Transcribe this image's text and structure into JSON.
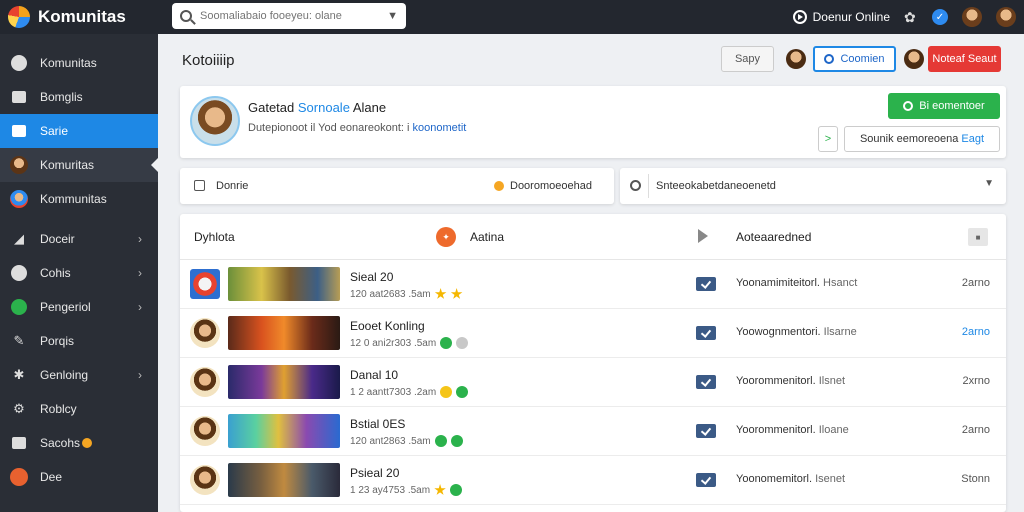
{
  "app": {
    "name": "Komunitas"
  },
  "search": {
    "placeholder": "Soomaliabaio fooeyeu: olane"
  },
  "topbar": {
    "online_label": "Doenur Online"
  },
  "sidebar": {
    "items": [
      {
        "label": "Komunitas",
        "icon": "dot-icon"
      },
      {
        "label": "Bomglis",
        "icon": "square-icon"
      },
      {
        "label": "Sarie",
        "icon": "folder-icon"
      },
      {
        "label": "Komuritas",
        "icon": "avatar-icon"
      },
      {
        "label": "Kommunitas",
        "icon": "avatar-icon"
      },
      {
        "label": "Doceir",
        "icon": "chart-icon"
      },
      {
        "label": "Cohis",
        "icon": "dot-icon"
      },
      {
        "label": "Pengeriol",
        "icon": "green-circle-icon"
      },
      {
        "label": "Porqis",
        "icon": "pin-icon"
      },
      {
        "label": "Genloing",
        "icon": "star-icon"
      },
      {
        "label": "Roblcy",
        "icon": "gear-icon"
      },
      {
        "label": "Sacohs",
        "icon": "folder-icon"
      },
      {
        "label": "Dee",
        "icon": "avatar-icon"
      }
    ]
  },
  "header": {
    "title": "Kotoiiiip",
    "save_label": "Sapy",
    "outline_label": "Coomien",
    "red_label": "Noteaf Seaut"
  },
  "profile": {
    "name_a": "Gatetad",
    "name_b": "Sornoale",
    "name_c": "Alane",
    "sub_a": "Dutepionoot il Yod  eonareokont: i",
    "sub_b": "koonometit",
    "green_label": "Bi eomentoer",
    "arrow_label": ">",
    "sub_btn_a": "Sounik eemoreoena",
    "sub_btn_b": "Eagt"
  },
  "filters": {
    "left_label": "Donrie",
    "middle_label": "Dooromoeoehad",
    "search_placeholder": "Snteeokabetdaneoenetd"
  },
  "table": {
    "headers": {
      "col1": "Dyhlota",
      "col2": "Aatina",
      "col3": "Aoteaaredned"
    },
    "rows": [
      {
        "title": "Sieal 20",
        "meta": "120 aat2683 .5am",
        "status": [
          "star",
          "star"
        ],
        "desc": "Yoonamimiteitorl.",
        "desc2": "Hsanct",
        "count": "2arno",
        "count_blue": false,
        "badge": "square",
        "thumb": "linear-gradient(90deg,#6b8f3a,#d9c24a 30%,#7a5a2e 55%,#3c5f86 80%,#b79d55)"
      },
      {
        "title": "Eooet Konling",
        "meta": "12 0 ani2r303 .5am",
        "status": [
          "check",
          "grey"
        ],
        "desc": "Yoowognmentori.",
        "desc2": "Ilsarne",
        "count": "2arno",
        "count_blue": true,
        "badge": "round",
        "thumb": "linear-gradient(90deg,#5a2a1a,#d9521f 30%,#f08a2a 50%,#6b2b1a 75%,#2a1a14)"
      },
      {
        "title": "Danal 10",
        "meta": "1 2 aantt7303 .2am",
        "status": [
          "yellow",
          "check"
        ],
        "desc": "Yoorommenitorl.",
        "desc2": "Ilsnet",
        "count": "2xrno",
        "count_blue": false,
        "badge": "round",
        "thumb": "linear-gradient(90deg,#2a2a6a,#7a3a9a 30%,#e0a030 50%,#4a2a8a 75%,#1a1a4a)"
      },
      {
        "title": "Bstial 0ES",
        "meta": "120 ant2863 .5am",
        "status": [
          "check",
          "check"
        ],
        "desc": "Yoorommenitorl.",
        "desc2": "Iloane",
        "count": "2arno",
        "count_blue": false,
        "badge": "round",
        "thumb": "linear-gradient(90deg,#3aa0d0,#5ad0a0 25%,#e0c040 45%,#8a4ab0 70%,#2a6ad0)"
      },
      {
        "title": "Psieal 20",
        "meta": "1 23 ay4753 .5am",
        "status": [
          "star",
          "check"
        ],
        "desc": "Yoonomemitorl.",
        "desc2": "Isenet",
        "count": "Stonn",
        "count_blue": false,
        "badge": "round",
        "thumb": "linear-gradient(90deg,#2a3a4a,#7a6040 30%,#c08a40 50%,#4a5a6a 75%,#2a2a3a)"
      }
    ]
  }
}
